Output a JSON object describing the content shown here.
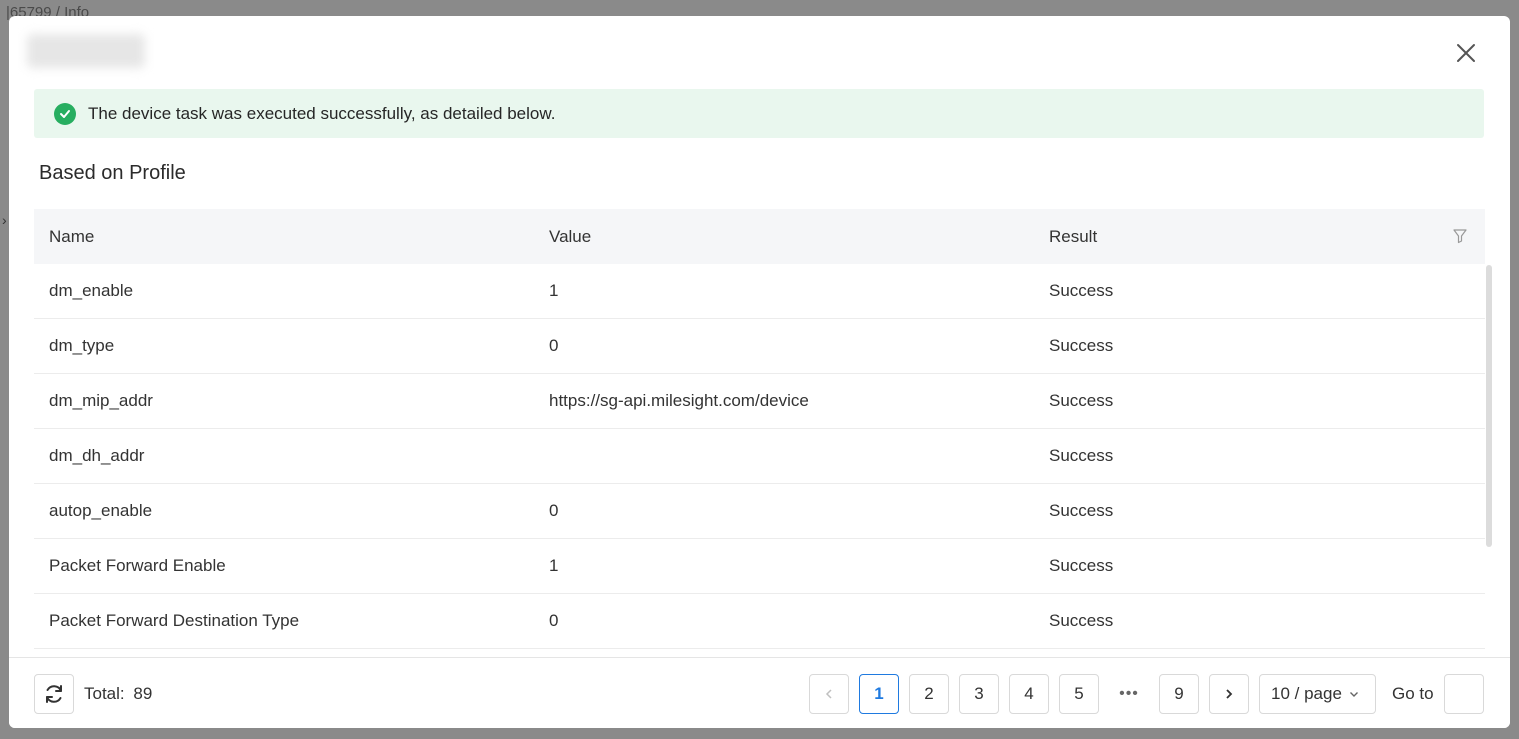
{
  "backdrop": {
    "breadcrumb": "|65799  /  Info"
  },
  "alert": {
    "message": "The device task was executed successfully, as detailed below."
  },
  "section": {
    "title": "Based on Profile"
  },
  "table": {
    "headers": [
      "Name",
      "Value",
      "Result"
    ],
    "rows": [
      {
        "name": "dm_enable",
        "value": "1",
        "result": "Success"
      },
      {
        "name": "dm_type",
        "value": "0",
        "result": "Success"
      },
      {
        "name": "dm_mip_addr",
        "value": "https://sg-api.milesight.com/device",
        "result": "Success"
      },
      {
        "name": "dm_dh_addr",
        "value": "",
        "result": "Success"
      },
      {
        "name": "autop_enable",
        "value": "0",
        "result": "Success"
      },
      {
        "name": "Packet Forward Enable",
        "value": "1",
        "result": "Success"
      },
      {
        "name": "Packet Forward Destination Type",
        "value": "0",
        "result": "Success"
      }
    ]
  },
  "footer": {
    "total_label": "Total:",
    "total_value": "89",
    "pages": [
      "1",
      "2",
      "3",
      "4",
      "5"
    ],
    "ellipsis": "•••",
    "last_page": "9",
    "current_page": "1",
    "page_size": "10 / page",
    "goto_label": "Go to",
    "goto_value": ""
  },
  "colors": {
    "success": "#27ae60",
    "accent": "#1f7ae0",
    "alert_bg": "#e9f7ee"
  },
  "icons": [
    "close-icon",
    "check-circle-icon",
    "filter-icon",
    "refresh-icon",
    "chevron-left-icon",
    "chevron-right-icon",
    "chevron-down-icon"
  ]
}
